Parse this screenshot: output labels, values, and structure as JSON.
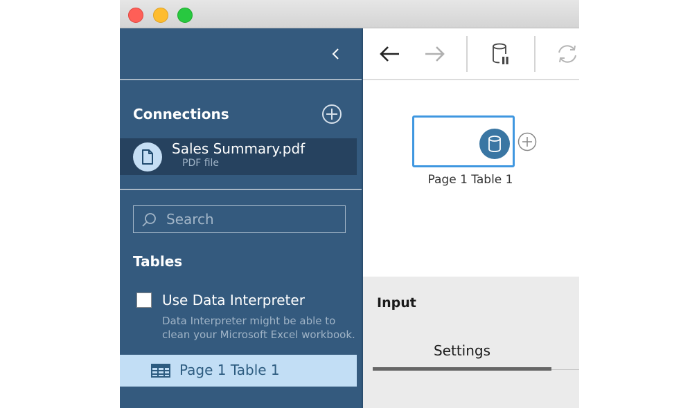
{
  "window": {
    "controls": [
      "close",
      "minimize",
      "zoom"
    ]
  },
  "sidebar": {
    "collapse_icon": "chevron-left-icon",
    "connections": {
      "title": "Connections",
      "add_icon": "plus-circle-icon",
      "items": [
        {
          "name": "Sales Summary.pdf",
          "type": "PDF file",
          "icon": "file-icon"
        }
      ]
    },
    "search": {
      "placeholder": "Search",
      "value": ""
    },
    "tables": {
      "title": "Tables",
      "data_interpreter": {
        "label": "Use Data Interpreter",
        "checked": false,
        "description": "Data Interpreter might be able to clean your Microsoft Excel workbook."
      },
      "items": [
        {
          "name": "Page 1 Table 1",
          "icon": "table-grid-icon",
          "selected": true
        }
      ]
    }
  },
  "toolbar": {
    "buttons": [
      {
        "name": "back",
        "icon": "arrow-left-icon",
        "enabled": true
      },
      {
        "name": "forward",
        "icon": "arrow-right-icon",
        "enabled": false
      },
      {
        "name": "pause-data-updates",
        "icon": "database-pause-icon",
        "enabled": true
      },
      {
        "name": "refresh",
        "icon": "refresh-icon",
        "enabled": false
      }
    ]
  },
  "canvas": {
    "nodes": [
      {
        "label": "Page 1 Table 1",
        "icon": "database-icon",
        "selected": true
      }
    ]
  },
  "panel": {
    "title": "Input",
    "tabs": [
      {
        "label": "Settings",
        "active": true
      }
    ]
  },
  "colors": {
    "sidebar_bg": "#345a7e",
    "selected_connection_bg": "#26425f",
    "selected_table_bg": "#c2def5",
    "node_border": "#3f97e0",
    "node_icon_bg": "#3a76a3"
  }
}
